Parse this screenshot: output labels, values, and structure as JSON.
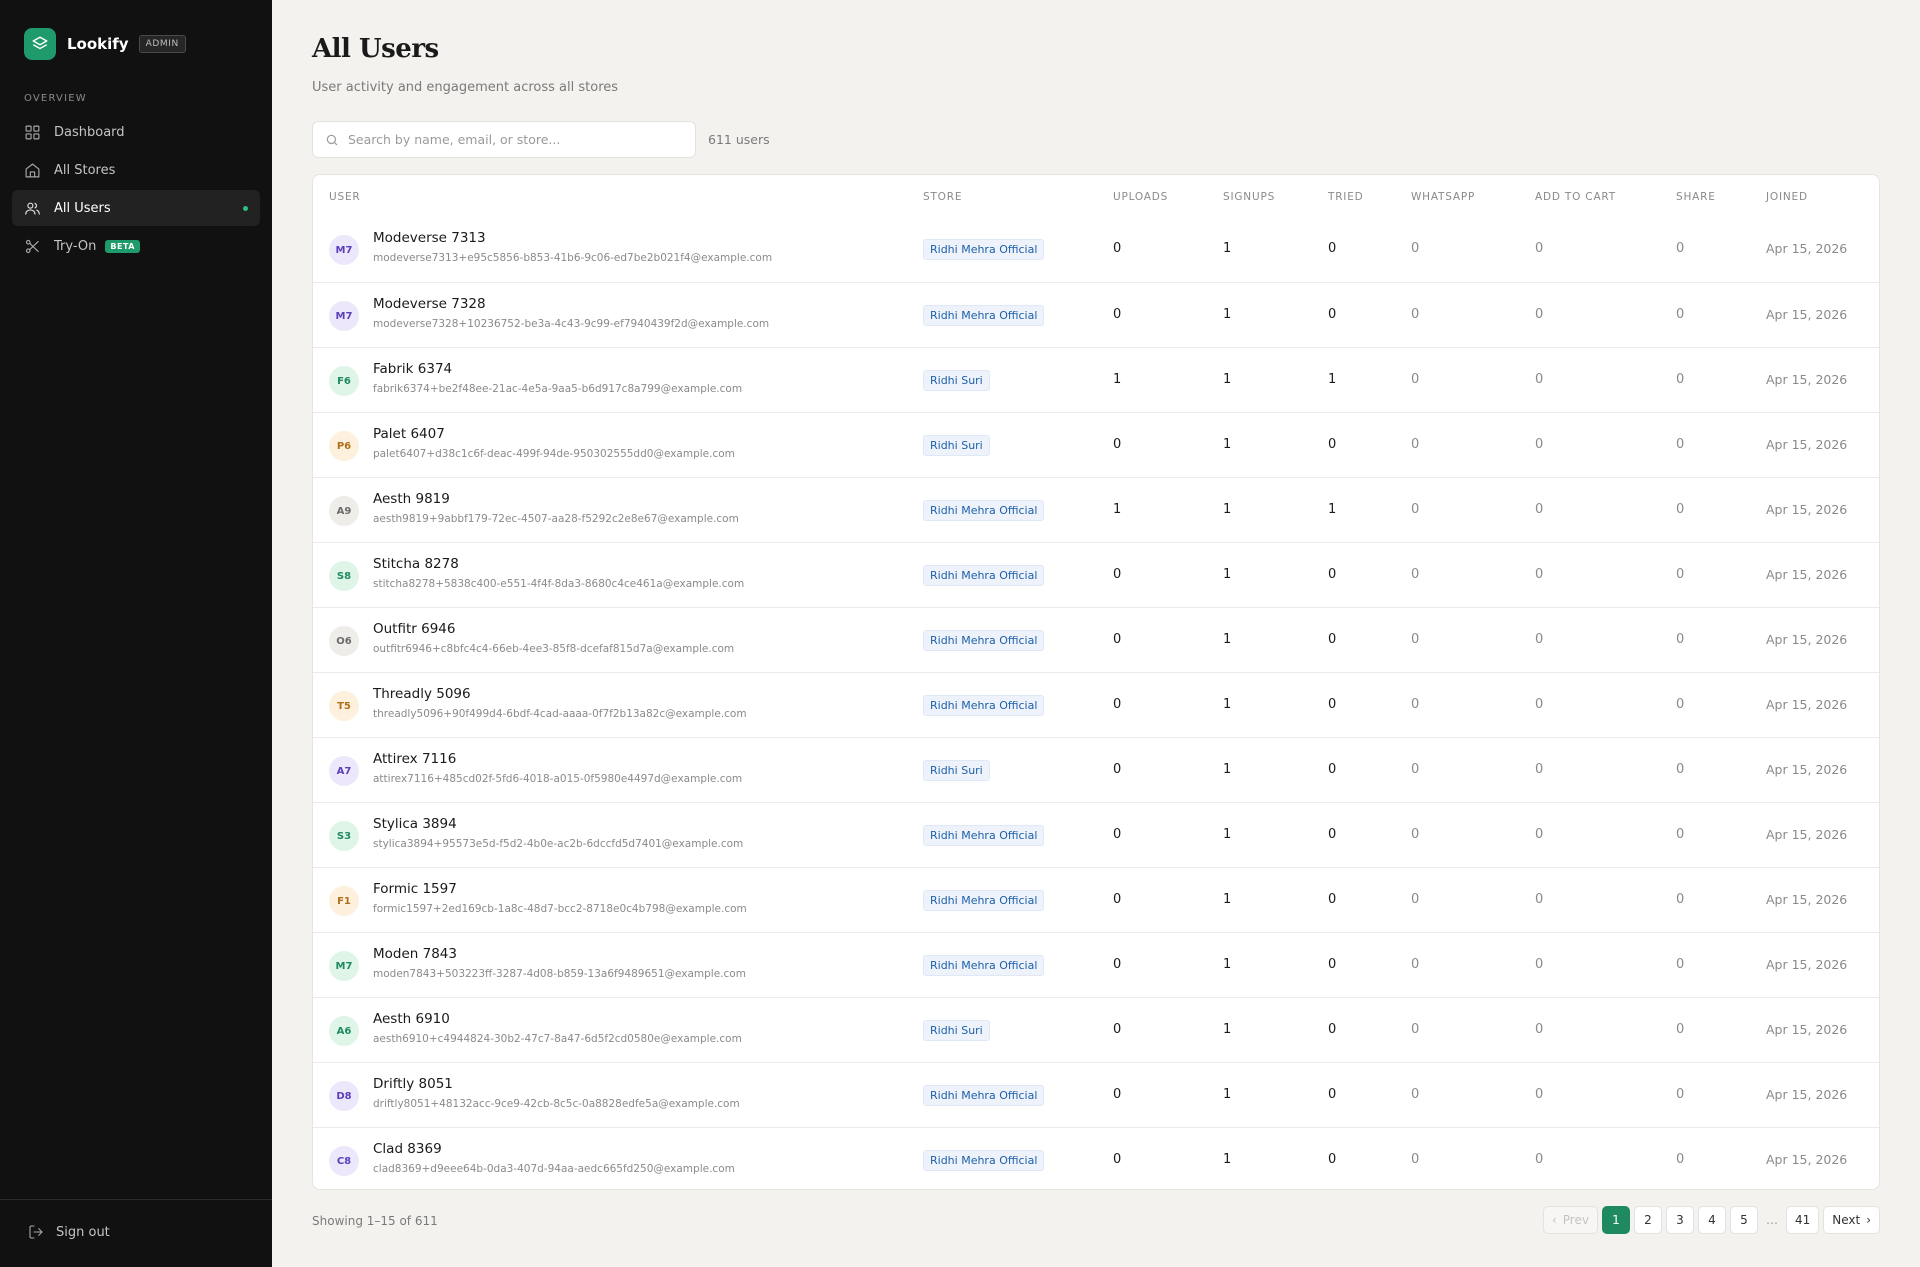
{
  "brand": {
    "name": "Lookify",
    "badge": "ADMIN"
  },
  "sidebar": {
    "section_title": "OVERVIEW",
    "items": [
      {
        "label": "Dashboard",
        "icon": "grid-icon",
        "active": false
      },
      {
        "label": "All Stores",
        "icon": "store-icon",
        "active": false
      },
      {
        "label": "All Users",
        "icon": "users-icon",
        "active": true
      },
      {
        "label": "Try-On",
        "icon": "scissors-icon",
        "active": false,
        "badge": "BETA"
      }
    ],
    "signout_label": "Sign out"
  },
  "page": {
    "title": "All Users",
    "subtitle": "User activity and engagement across all stores"
  },
  "search": {
    "placeholder": "Search by name, email, or store..."
  },
  "user_count": "611 users",
  "table": {
    "columns": [
      "USER",
      "STORE",
      "UPLOADS",
      "SIGNUPS",
      "TRIED",
      "WHATSAPP",
      "ADD TO CART",
      "SHARE",
      "JOINED"
    ],
    "rows": [
      {
        "initials": "M7",
        "name": "Modeverse 7313",
        "email": "modeverse7313+e95c5856-b853-41b6-9c06-ed7be2b021f4@example.com",
        "store": "Ridhi Mehra Official",
        "uploads": "0",
        "signups": "1",
        "tried": "0",
        "whatsapp": "0",
        "add_to_cart": "0",
        "share": "0",
        "joined": "Apr 15, 2026",
        "avatar_bg": "#ece7fb",
        "avatar_fg": "#5b3fb8"
      },
      {
        "initials": "M7",
        "name": "Modeverse 7328",
        "email": "modeverse7328+10236752-be3a-4c43-9c99-ef7940439f2d@example.com",
        "store": "Ridhi Mehra Official",
        "uploads": "0",
        "signups": "1",
        "tried": "0",
        "whatsapp": "0",
        "add_to_cart": "0",
        "share": "0",
        "joined": "Apr 15, 2026",
        "avatar_bg": "#ece7fb",
        "avatar_fg": "#5b3fb8"
      },
      {
        "initials": "F6",
        "name": "Fabrik 6374",
        "email": "fabrik6374+be2f48ee-21ac-4e5a-9aa5-b6d917c8a799@example.com",
        "store": "Ridhi Suri",
        "uploads": "1",
        "signups": "1",
        "tried": "1",
        "whatsapp": "0",
        "add_to_cart": "0",
        "share": "0",
        "joined": "Apr 15, 2026",
        "avatar_bg": "#def5e8",
        "avatar_fg": "#1f8a5f"
      },
      {
        "initials": "P6",
        "name": "Palet 6407",
        "email": "palet6407+d38c1c6f-deac-499f-94de-950302555dd0@example.com",
        "store": "Ridhi Suri",
        "uploads": "0",
        "signups": "1",
        "tried": "0",
        "whatsapp": "0",
        "add_to_cart": "0",
        "share": "0",
        "joined": "Apr 15, 2026",
        "avatar_bg": "#fdf0dc",
        "avatar_fg": "#b0701b"
      },
      {
        "initials": "A9",
        "name": "Aesth 9819",
        "email": "aesth9819+9abbf179-72ec-4507-aa28-f5292c2e8e67@example.com",
        "store": "Ridhi Mehra Official",
        "uploads": "1",
        "signups": "1",
        "tried": "1",
        "whatsapp": "0",
        "add_to_cart": "0",
        "share": "0",
        "joined": "Apr 15, 2026",
        "avatar_bg": "#efedea",
        "avatar_fg": "#6b6b6b"
      },
      {
        "initials": "S8",
        "name": "Stitcha 8278",
        "email": "stitcha8278+5838c400-e551-4f4f-8da3-8680c4ce461a@example.com",
        "store": "Ridhi Mehra Official",
        "uploads": "0",
        "signups": "1",
        "tried": "0",
        "whatsapp": "0",
        "add_to_cart": "0",
        "share": "0",
        "joined": "Apr 15, 2026",
        "avatar_bg": "#def5e8",
        "avatar_fg": "#1f8a5f"
      },
      {
        "initials": "O6",
        "name": "Outfitr 6946",
        "email": "outfitr6946+c8bfc4c4-66eb-4ee3-85f8-dcefaf815d7a@example.com",
        "store": "Ridhi Mehra Official",
        "uploads": "0",
        "signups": "1",
        "tried": "0",
        "whatsapp": "0",
        "add_to_cart": "0",
        "share": "0",
        "joined": "Apr 15, 2026",
        "avatar_bg": "#efedea",
        "avatar_fg": "#6b6b6b"
      },
      {
        "initials": "T5",
        "name": "Threadly 5096",
        "email": "threadly5096+90f499d4-6bdf-4cad-aaaa-0f7f2b13a82c@example.com",
        "store": "Ridhi Mehra Official",
        "uploads": "0",
        "signups": "1",
        "tried": "0",
        "whatsapp": "0",
        "add_to_cart": "0",
        "share": "0",
        "joined": "Apr 15, 2026",
        "avatar_bg": "#fdf0dc",
        "avatar_fg": "#b0701b"
      },
      {
        "initials": "A7",
        "name": "Attirex 7116",
        "email": "attirex7116+485cd02f-5fd6-4018-a015-0f5980e4497d@example.com",
        "store": "Ridhi Suri",
        "uploads": "0",
        "signups": "1",
        "tried": "0",
        "whatsapp": "0",
        "add_to_cart": "0",
        "share": "0",
        "joined": "Apr 15, 2026",
        "avatar_bg": "#ece7fb",
        "avatar_fg": "#5b3fb8"
      },
      {
        "initials": "S3",
        "name": "Stylica 3894",
        "email": "stylica3894+95573e5d-f5d2-4b0e-ac2b-6dccfd5d7401@example.com",
        "store": "Ridhi Mehra Official",
        "uploads": "0",
        "signups": "1",
        "tried": "0",
        "whatsapp": "0",
        "add_to_cart": "0",
        "share": "0",
        "joined": "Apr 15, 2026",
        "avatar_bg": "#def5e8",
        "avatar_fg": "#1f8a5f"
      },
      {
        "initials": "F1",
        "name": "Formic 1597",
        "email": "formic1597+2ed169cb-1a8c-48d7-bcc2-8718e0c4b798@example.com",
        "store": "Ridhi Mehra Official",
        "uploads": "0",
        "signups": "1",
        "tried": "0",
        "whatsapp": "0",
        "add_to_cart": "0",
        "share": "0",
        "joined": "Apr 15, 2026",
        "avatar_bg": "#fdf0dc",
        "avatar_fg": "#b0701b"
      },
      {
        "initials": "M7",
        "name": "Moden 7843",
        "email": "moden7843+503223ff-3287-4d08-b859-13a6f9489651@example.com",
        "store": "Ridhi Mehra Official",
        "uploads": "0",
        "signups": "1",
        "tried": "0",
        "whatsapp": "0",
        "add_to_cart": "0",
        "share": "0",
        "joined": "Apr 15, 2026",
        "avatar_bg": "#def5e8",
        "avatar_fg": "#1f8a5f"
      },
      {
        "initials": "A6",
        "name": "Aesth 6910",
        "email": "aesth6910+c4944824-30b2-47c7-8a47-6d5f2cd0580e@example.com",
        "store": "Ridhi Suri",
        "uploads": "0",
        "signups": "1",
        "tried": "0",
        "whatsapp": "0",
        "add_to_cart": "0",
        "share": "0",
        "joined": "Apr 15, 2026",
        "avatar_bg": "#def5e8",
        "avatar_fg": "#1f8a5f"
      },
      {
        "initials": "D8",
        "name": "Driftly 8051",
        "email": "driftly8051+48132acc-9ce9-42cb-8c5c-0a8828edfe5a@example.com",
        "store": "Ridhi Mehra Official",
        "uploads": "0",
        "signups": "1",
        "tried": "0",
        "whatsapp": "0",
        "add_to_cart": "0",
        "share": "0",
        "joined": "Apr 15, 2026",
        "avatar_bg": "#ece7fb",
        "avatar_fg": "#5b3fb8"
      },
      {
        "initials": "C8",
        "name": "Clad 8369",
        "email": "clad8369+d9eee64b-0da3-407d-94aa-aedc665fd250@example.com",
        "store": "Ridhi Mehra Official",
        "uploads": "0",
        "signups": "1",
        "tried": "0",
        "whatsapp": "0",
        "add_to_cart": "0",
        "share": "0",
        "joined": "Apr 15, 2026",
        "avatar_bg": "#ece7fb",
        "avatar_fg": "#5b3fb8"
      }
    ]
  },
  "pagination": {
    "showing": "Showing 1–15 of 611",
    "prev": "Prev",
    "next": "Next",
    "pages": [
      "1",
      "2",
      "3",
      "4",
      "5"
    ],
    "ellipsis": "…",
    "last": "41",
    "current": "1"
  },
  "colors": {
    "accent": "#1f8a5f",
    "sidebar_bg": "#111111",
    "page_bg": "#f3f2ef"
  }
}
